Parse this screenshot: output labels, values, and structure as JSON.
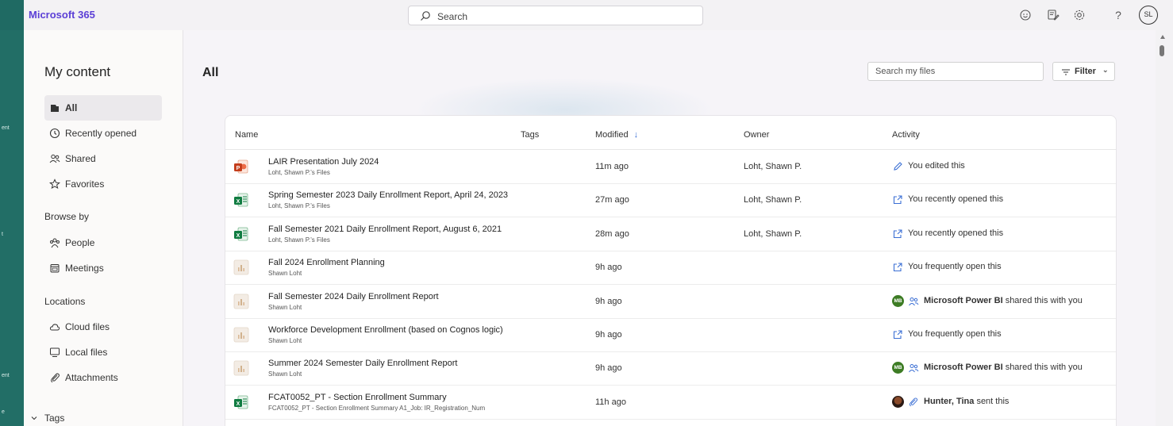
{
  "app": {
    "title": "Microsoft 365"
  },
  "topbar": {
    "search_placeholder": "Search",
    "avatar_initials": "SL"
  },
  "frame_left": {
    "fragments": [
      "ent",
      "t",
      "ent",
      "e"
    ]
  },
  "sidebar": {
    "title": "My content",
    "items": [
      {
        "label": "All",
        "icon": "all-files-icon",
        "active": true
      },
      {
        "label": "Recently opened",
        "icon": "clock-icon"
      },
      {
        "label": "Shared",
        "icon": "people-icon"
      },
      {
        "label": "Favorites",
        "icon": "star-icon"
      }
    ],
    "browse_heading": "Browse by",
    "browse_items": [
      {
        "label": "People",
        "icon": "people-group-icon"
      },
      {
        "label": "Meetings",
        "icon": "calendar-icon"
      }
    ],
    "locations_heading": "Locations",
    "location_items": [
      {
        "label": "Cloud files",
        "icon": "cloud-icon"
      },
      {
        "label": "Local files",
        "icon": "computer-icon"
      },
      {
        "label": "Attachments",
        "icon": "paperclip-icon"
      }
    ],
    "tags_heading": "Tags"
  },
  "main": {
    "title": "All",
    "search_files_placeholder": "Search my files",
    "filter_label": "Filter",
    "columns": {
      "name": "Name",
      "tags": "Tags",
      "modified": "Modified",
      "owner": "Owner",
      "activity": "Activity"
    },
    "rows": [
      {
        "type": "powerpoint",
        "name": "LAIR Presentation July 2024",
        "location": "Loht, Shawn P.'s Files",
        "modified": "11m ago",
        "owner": "Loht, Shawn P.",
        "activity": {
          "kind": "edited",
          "text": "You edited this"
        }
      },
      {
        "type": "excel",
        "name": "Spring Semester 2023 Daily Enrollment Report, April 24, 2023",
        "location": "Loht, Shawn P.'s Files",
        "modified": "27m ago",
        "owner": "Loht, Shawn P.",
        "activity": {
          "kind": "opened",
          "text": "You recently opened this"
        }
      },
      {
        "type": "excel",
        "name": "Fall Semester 2021 Daily Enrollment Report, August 6, 2021",
        "location": "Loht, Shawn P.'s Files",
        "modified": "28m ago",
        "owner": "Loht, Shawn P.",
        "activity": {
          "kind": "opened",
          "text": "You recently opened this"
        }
      },
      {
        "type": "powerbi",
        "name": "Fall 2024 Enrollment Planning",
        "location": "Shawn Loht",
        "modified": "9h ago",
        "owner": "",
        "activity": {
          "kind": "opened",
          "text": "You frequently open this"
        }
      },
      {
        "type": "powerbi",
        "name": "Fall Semester 2024 Daily Enrollment Report",
        "location": "Shawn Loht",
        "modified": "9h ago",
        "owner": "",
        "activity": {
          "kind": "shared",
          "badge": "MB",
          "actor": "Microsoft Power BI",
          "text": "shared this with you"
        }
      },
      {
        "type": "powerbi",
        "name": "Workforce Development Enrollment (based on Cognos logic)",
        "location": "Shawn Loht",
        "modified": "9h ago",
        "owner": "",
        "activity": {
          "kind": "opened",
          "text": "You frequently open this"
        }
      },
      {
        "type": "powerbi",
        "name": "Summer 2024 Semester Daily Enrollment Report",
        "location": "Shawn Loht",
        "modified": "9h ago",
        "owner": "",
        "activity": {
          "kind": "shared",
          "badge": "MB",
          "actor": "Microsoft Power BI",
          "text": "shared this with you"
        }
      },
      {
        "type": "excel",
        "name": "FCAT0052_PT - Section Enrollment Summary",
        "location": "FCAT0052_PT - Section Enrollment Summary A1_Job: IR_Registration_Num",
        "modified": "11h ago",
        "owner": "",
        "activity": {
          "kind": "sent",
          "actor": "Hunter, Tina",
          "text": "sent this"
        }
      }
    ]
  },
  "colors": {
    "brand": "#5b3fd6",
    "frame": "#1f6a63",
    "accent_blue": "#3b6fd4",
    "excel_green": "#107c41",
    "ppt_red": "#c43e1c",
    "powerbi_badge": "#3d7c24"
  }
}
